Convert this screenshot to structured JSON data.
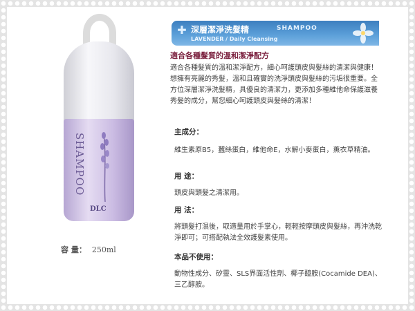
{
  "banner": {
    "title": "深層潔淨洗髮精",
    "title_en": "SHAMPOO",
    "subtitle": "LAVENDER / Daily Cleansing"
  },
  "headline": "適合各種髮質的溫和潔淨配方",
  "description": "適合各種髮質的溫和潔淨配方，細心呵護頭皮與髮絲的清潔與健康！想擁有亮麗的秀髮，溫和且確實的洗淨頭皮與髮絲的污垢很重要。全方位深層潔淨洗髮精，具優良的清潔力，更添加多種維他命保護滋養秀髮的成分，幫您細心呵護頭皮與髮絲的清潔！",
  "sections": [
    {
      "title": "主成分：",
      "body": "維生素原B5，蠶絲蛋白，維他命E，水解小麥蛋白，薰衣草精油。"
    },
    {
      "title": "用 途：",
      "body": "頭皮與頭髮之清潔用。"
    },
    {
      "title": "用 法：",
      "body": "將頭髮打濕後，取適量用於手掌心，輕輕按摩頭皮與髮絲，再沖洗乾淨即可；可搭配執法全效護髮素使用。"
    },
    {
      "title": "本品不使用：",
      "body": "動物性成分、矽靈、SLS界面活性劑、椰子醯胺(Cocamide DEA)、三乙醇胺。"
    }
  ],
  "product": {
    "bottle_word": "SHAMPOO",
    "brand": "DLC",
    "volume_label": "容 量：",
    "volume_value": "250ml"
  },
  "colors": {
    "banner": "#4a8fcf",
    "headline": "#7a1f3d",
    "bottle": "#c6b6e0"
  }
}
